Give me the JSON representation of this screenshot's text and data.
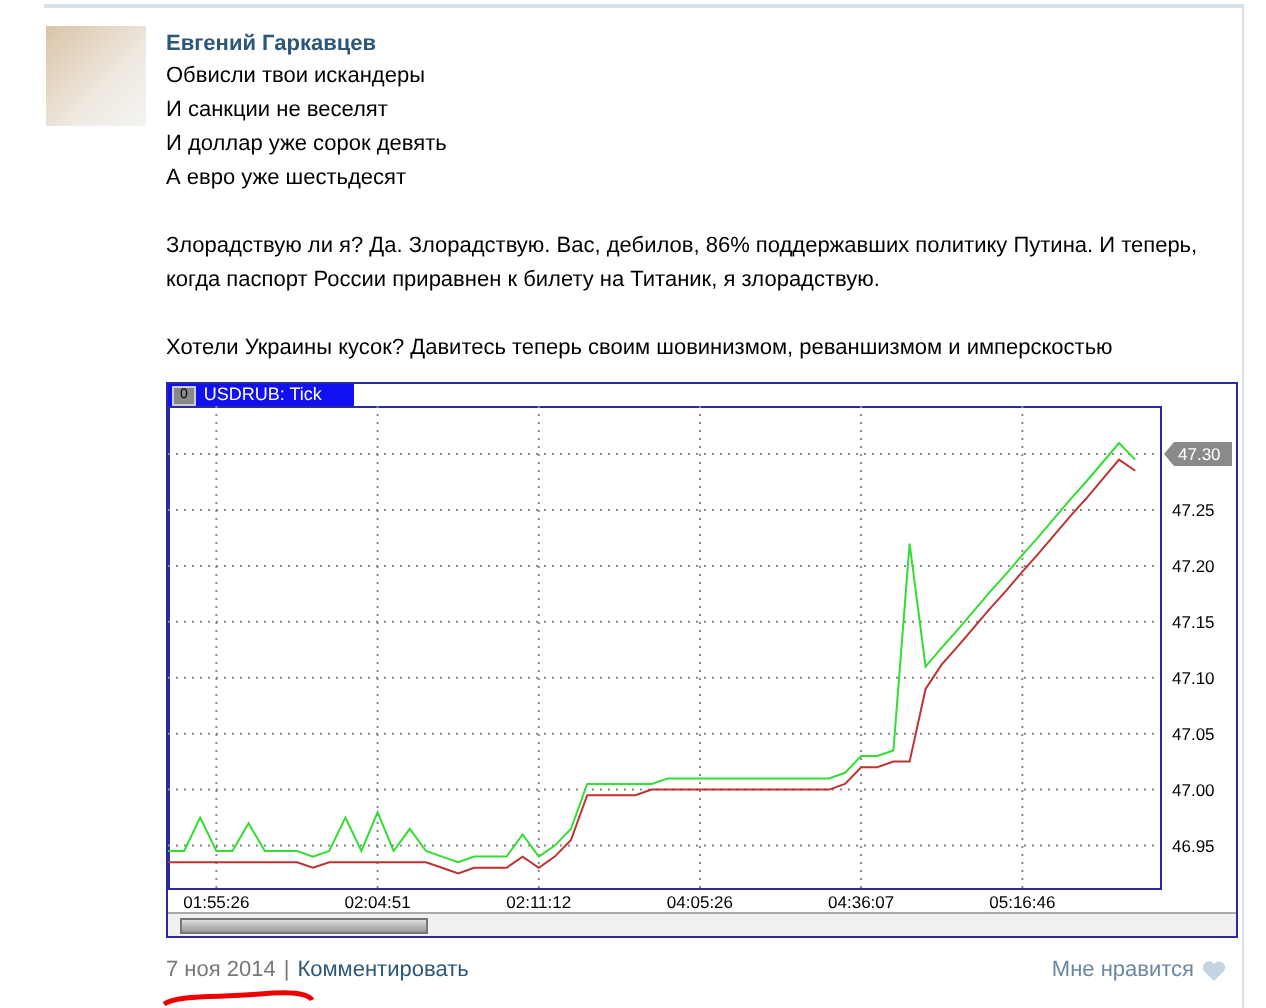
{
  "post": {
    "author": "Евгений Гаркавцев",
    "lines": [
      "Обвисли твои искандеры",
      "И санкции не веселят",
      "И доллар уже сорок девять",
      "А евро уже шестьдесят"
    ],
    "paragraphs": [
      "Злорадствую ли я? Да. Злорадствую. Вас, дебилов, 86% поддержавших политику Путина. И теперь, когда паспорт России приравнен к билету на Титаник, я злорадствую.",
      "Хотели Украины кусок? Давитесь теперь своим шовинизмом, реваншизмом и имперскостью"
    ]
  },
  "chart": {
    "title_badge": "0",
    "price_tag": "47.30",
    "chart_data": {
      "type": "line",
      "grid": true,
      "title": "USDRUB: Tick",
      "ylim": [
        46.912,
        47.343
      ],
      "categories": [
        null,
        null,
        null,
        "01:55:26",
        null,
        null,
        null,
        null,
        null,
        null,
        null,
        null,
        null,
        "02:04:51",
        null,
        null,
        null,
        null,
        null,
        null,
        null,
        null,
        null,
        "02:11:12",
        null,
        null,
        null,
        null,
        null,
        null,
        null,
        null,
        null,
        "04:05:26",
        null,
        null,
        null,
        null,
        null,
        null,
        null,
        null,
        null,
        "04:36:07",
        null,
        null,
        null,
        null,
        null,
        null,
        null,
        null,
        null,
        "05:16:46",
        null,
        null,
        null,
        null,
        null,
        null,
        null
      ],
      "series": [
        {
          "color": "#33dd33",
          "values": [
            46.945,
            46.945,
            46.975,
            46.945,
            46.945,
            46.97,
            46.945,
            46.945,
            46.945,
            46.94,
            46.945,
            46.975,
            46.945,
            46.98,
            46.945,
            46.965,
            46.945,
            46.94,
            46.935,
            46.94,
            46.94,
            46.94,
            46.96,
            46.94,
            46.95,
            46.965,
            47.005,
            47.005,
            47.005,
            47.005,
            47.005,
            47.01,
            47.01,
            47.01,
            47.01,
            47.01,
            47.01,
            47.01,
            47.01,
            47.01,
            47.01,
            47.01,
            47.015,
            47.03,
            47.03,
            47.035,
            47.22,
            47.11,
            47.127,
            47.143,
            47.16,
            47.177,
            47.193,
            47.21,
            47.226,
            47.243,
            47.26,
            47.276,
            47.293,
            47.31,
            47.295
          ]
        },
        {
          "color": "#bb3333",
          "values": [
            46.935,
            46.935,
            46.935,
            46.935,
            46.935,
            46.935,
            46.935,
            46.935,
            46.935,
            46.93,
            46.935,
            46.935,
            46.935,
            46.935,
            46.935,
            46.935,
            46.935,
            46.93,
            46.925,
            46.93,
            46.93,
            46.93,
            46.94,
            46.93,
            46.94,
            46.955,
            46.995,
            46.995,
            46.995,
            46.995,
            47.0,
            47.0,
            47.0,
            47.0,
            47.0,
            47.0,
            47.0,
            47.0,
            47.0,
            47.0,
            47.0,
            47.0,
            47.005,
            47.02,
            47.02,
            47.025,
            47.025,
            47.09,
            47.112,
            47.128,
            47.145,
            47.162,
            47.178,
            47.195,
            47.211,
            47.228,
            47.245,
            47.261,
            47.278,
            47.295,
            47.285
          ]
        }
      ],
      "yticks": [
        {
          "value": 46.95,
          "label": "46.95"
        },
        {
          "value": 47.0,
          "label": "47.00"
        },
        {
          "value": 47.05,
          "label": "47.05"
        },
        {
          "value": 47.1,
          "label": "47.10"
        },
        {
          "value": 47.15,
          "label": "47.15"
        },
        {
          "value": 47.2,
          "label": "47.20"
        },
        {
          "value": 47.25,
          "label": "47.25"
        }
      ]
    }
  },
  "footer": {
    "date": "7 ноя 2014",
    "separator": "|",
    "comment_link": "Комментировать",
    "like_label": "Мне нравится"
  }
}
